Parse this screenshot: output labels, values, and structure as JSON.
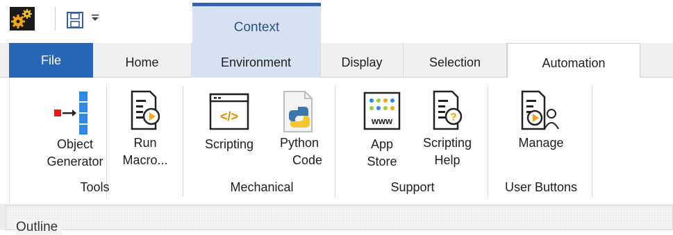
{
  "quick_access": {
    "app_icon": "gears-icon",
    "save_icon": "save-icon",
    "dropdown_icon": "caret-down-icon"
  },
  "context_tab": {
    "label": "Context"
  },
  "tabs": {
    "file": "File",
    "home": "Home",
    "environment": "Environment",
    "display": "Display",
    "selection": "Selection",
    "automation": "Automation",
    "active": "Automation"
  },
  "ribbon": {
    "tools": {
      "label": "Tools",
      "object_generator": {
        "line1": "Object",
        "line2": "Generator"
      },
      "run_macro": {
        "line1": "Run",
        "line2": "Macro..."
      }
    },
    "mechanical": {
      "label": "Mechanical",
      "scripting": {
        "line1": "Scripting"
      },
      "python_code": {
        "line1": "Python",
        "line2": "Code"
      }
    },
    "support": {
      "label": "Support",
      "app_store": {
        "line1": "App",
        "line2": "Store",
        "icon_text": "www"
      },
      "scripting_help": {
        "line1": "Scripting",
        "line2": "Help"
      }
    },
    "user_buttons": {
      "label": "User Buttons",
      "manage": {
        "line1": "Manage"
      }
    }
  },
  "outline": {
    "title": "Outline"
  },
  "colors": {
    "file_tab": "#2866b8",
    "context_accent": "#3563b3",
    "context_fill": "#d6e1f2",
    "object_generator_red": "#e31b1b",
    "object_generator_blue": "#2a8ae6"
  }
}
